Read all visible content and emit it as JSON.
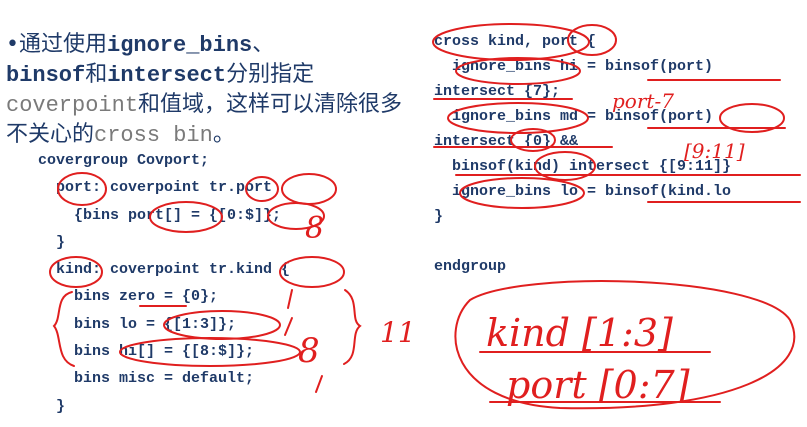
{
  "title": {
    "bullet": "•",
    "t1": "通过使用",
    "k1": "ignore_bins",
    "t2": "、",
    "k2": "binsof",
    "t3": "和",
    "k3": "intersect",
    "t4": "分别指定",
    "k4": "coverpoint",
    "t5": "和值域，这样可以清除很多不关心的",
    "k5": "cross bin",
    "t6": "。"
  },
  "code_left": [
    "covergroup Covport;",
    "  port: coverpoint tr.port",
    "    {bins port[] = {[0:$]};",
    "  }",
    "  kind: coverpoint tr.kind {",
    "    bins zero = {0};",
    "    bins lo = {[1:3]};",
    "    bins hi[] = {[8:$]};",
    "    bins misc = default;",
    "  }"
  ],
  "code_right": [
    "cross kind, port {",
    "  ignore_bins hi = binsof(port)",
    "intersect {7};",
    "  ignore_bins md = binsof(port)",
    "intersect {0} &&",
    "  binsof(kind) intersect {[9:11]}",
    "  ignore_bins lo = binsof(kind.lo",
    "}",
    "",
    "endgroup"
  ],
  "annotations": {
    "port7": "port-7",
    "range911": "[9:11]",
    "eight": "8",
    "slashes": "/",
    "eleven": "11",
    "kind13": "kind [1:3]",
    "port07": "port [0:7]"
  },
  "colors": {
    "title": "#1f3a68",
    "code": "#1f3a68",
    "ink": "#e01f1f"
  }
}
